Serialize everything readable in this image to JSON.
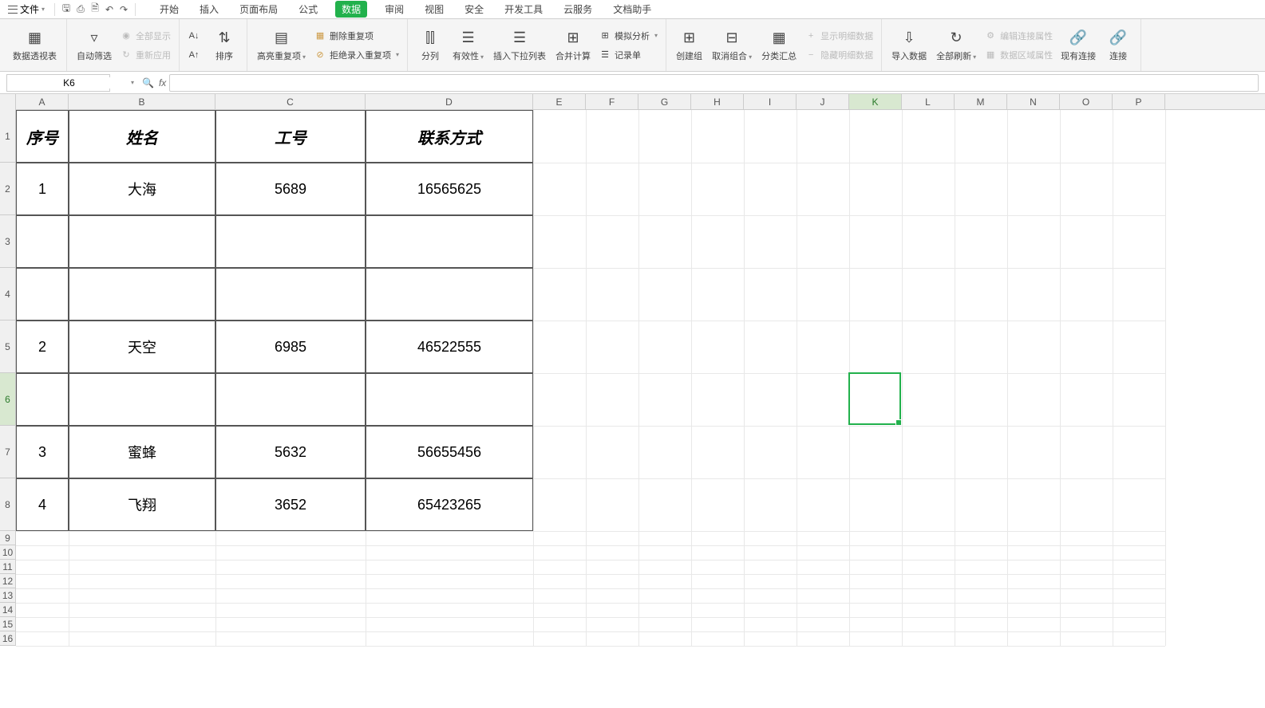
{
  "menu": {
    "file": "文件",
    "tabs": [
      "开始",
      "插入",
      "页面布局",
      "公式",
      "数据",
      "审阅",
      "视图",
      "安全",
      "开发工具",
      "云服务",
      "文档助手"
    ],
    "active_tab_index": 4
  },
  "ribbon": {
    "pivot": "数据透视表",
    "autofilter": "自动筛选",
    "show_all": "全部显示",
    "reapply": "重新应用",
    "sort": "排序",
    "highlight_dup": "高亮重复项",
    "remove_dup": "删除重复项",
    "reject_dup": "拒绝录入重复项",
    "text_to_cols": "分列",
    "validation": "有效性",
    "dropdown": "插入下拉列表",
    "consolidate": "合并计算",
    "whatif": "模拟分析",
    "record": "记录单",
    "group": "创建组",
    "ungroup": "取消组合",
    "subtotal": "分类汇总",
    "show_detail": "显示明细数据",
    "hide_detail": "隐藏明细数据",
    "import": "导入数据",
    "refresh_all": "全部刷新",
    "edit_conn": "编辑连接属性",
    "data_range": "数据区域属性",
    "existing_conn": "现有连接",
    "connections": "连接"
  },
  "formula_bar": {
    "cell_ref": "K6",
    "formula": ""
  },
  "columns": [
    "A",
    "B",
    "C",
    "D",
    "E",
    "F",
    "G",
    "H",
    "I",
    "J",
    "K",
    "L",
    "M",
    "N",
    "O",
    "P"
  ],
  "col_widths": {
    "A": 66,
    "B": 184,
    "C": 188,
    "D": 210,
    "E": 66,
    "F": 66,
    "G": 66,
    "H": 66,
    "I": 66,
    "J": 66,
    "K": 66,
    "L": 66,
    "M": 66,
    "N": 66,
    "O": 66,
    "P": 66
  },
  "row_heights": {
    "1": 66,
    "2": 66,
    "3": 66,
    "4": 66,
    "5": 66,
    "6": 66,
    "7": 66,
    "8": 66,
    "9": 18,
    "10": 18,
    "11": 18,
    "12": 18,
    "13": 18,
    "14": 18,
    "15": 18,
    "16": 18
  },
  "table": {
    "headers": {
      "A": "序号",
      "B": "姓名",
      "C": "工号",
      "D": "联系方式"
    },
    "rows": [
      {
        "row": 2,
        "A": "1",
        "B": "大海",
        "C": "5689",
        "D": "16565625"
      },
      {
        "row": 3,
        "A": "",
        "B": "",
        "C": "",
        "D": ""
      },
      {
        "row": 4,
        "A": "",
        "B": "",
        "C": "",
        "D": ""
      },
      {
        "row": 5,
        "A": "2",
        "B": "天空",
        "C": "6985",
        "D": "46522555"
      },
      {
        "row": 6,
        "A": "",
        "B": "",
        "C": "",
        "D": ""
      },
      {
        "row": 7,
        "A": "3",
        "B": "蜜蜂",
        "C": "5632",
        "D": "56655456"
      },
      {
        "row": 8,
        "A": "4",
        "B": "飞翔",
        "C": "3652",
        "D": "65423265"
      }
    ]
  },
  "selection": {
    "col": "K",
    "row": 6
  }
}
